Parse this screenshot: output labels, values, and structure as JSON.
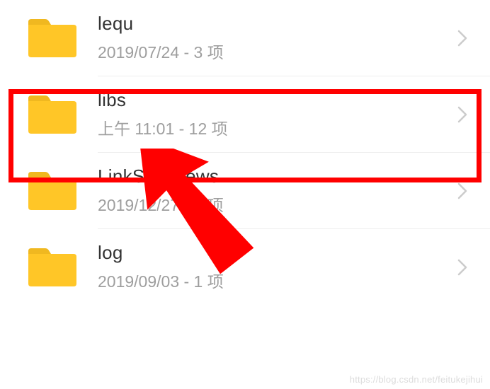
{
  "files": [
    {
      "name": "lequ",
      "meta": "2019/07/24 - 3 项"
    },
    {
      "name": "libs",
      "meta": "上午 11:01  - 12 项"
    },
    {
      "name": "LinkSureNews",
      "meta": "2019/12/27 - 2 项"
    },
    {
      "name": "log",
      "meta": "2019/09/03 - 1 项"
    }
  ],
  "watermark": "https://blog.csdn.net/feitukejihui",
  "highlight": {
    "index": 1,
    "color": "#ff0000"
  }
}
